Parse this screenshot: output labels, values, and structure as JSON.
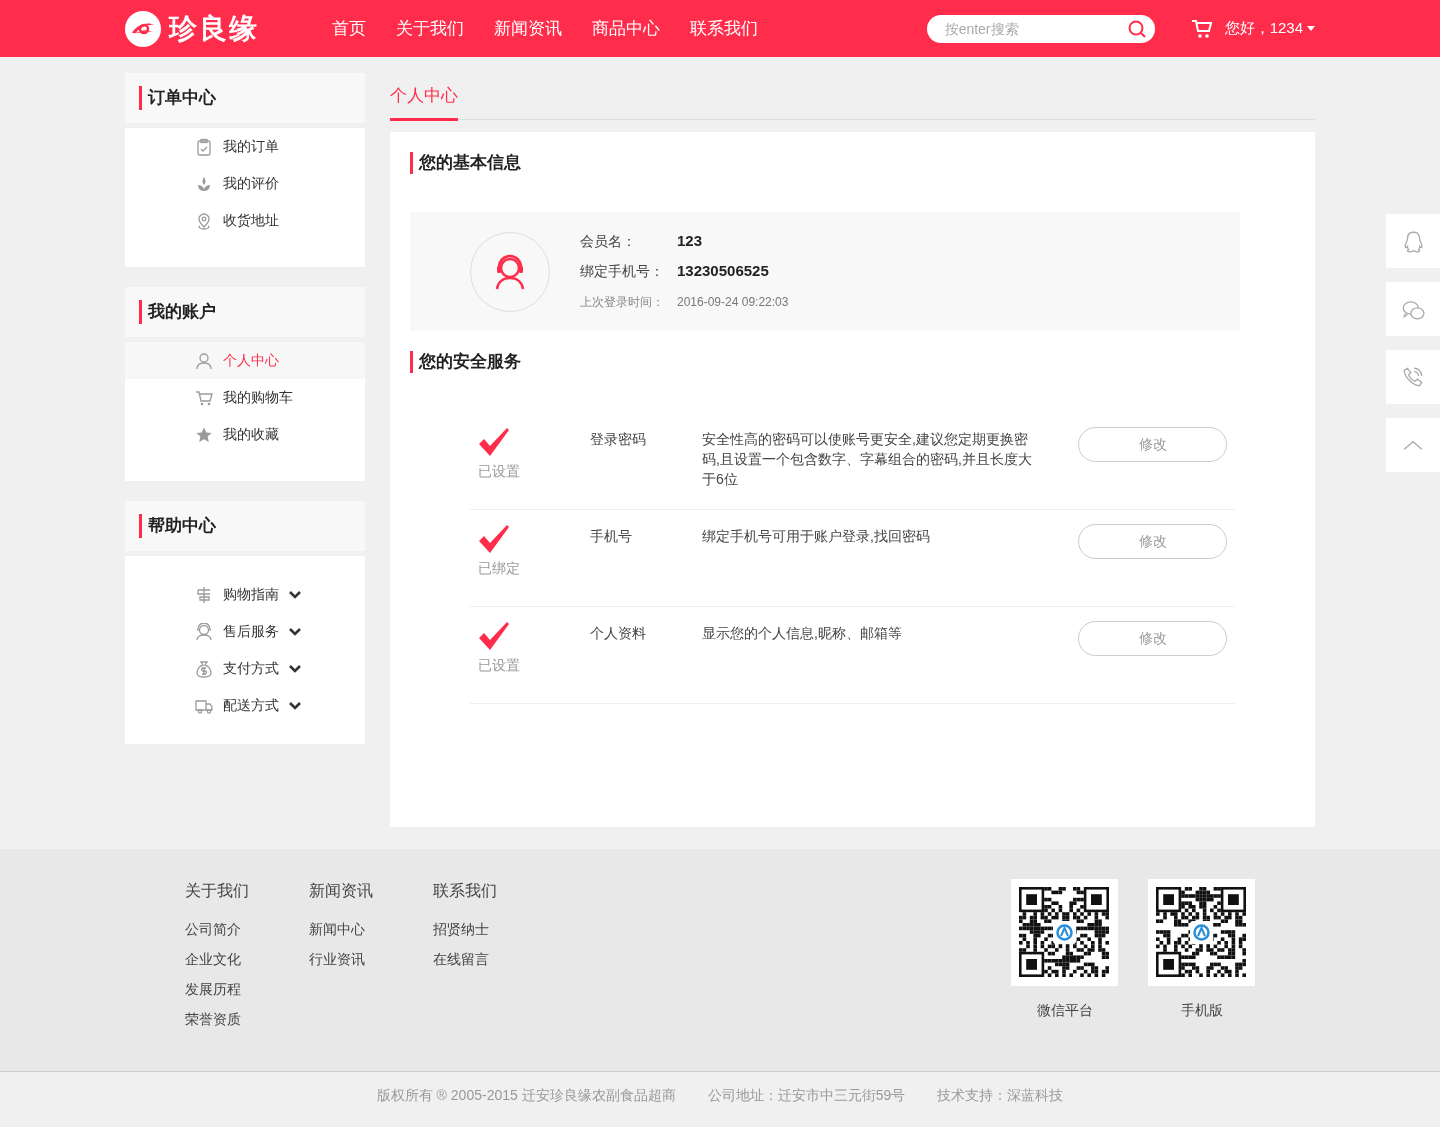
{
  "header": {
    "logo_text": "珍良缘",
    "nav": [
      {
        "label": "首页"
      },
      {
        "label": "关于我们"
      },
      {
        "label": "新闻资讯"
      },
      {
        "label": "商品中心"
      },
      {
        "label": "联系我们"
      }
    ],
    "search": {
      "placeholder": "按enter搜索"
    },
    "greeting": "您好，1234"
  },
  "sidebar": {
    "sections": [
      {
        "title": "订单中心",
        "items": [
          {
            "label": "我的订单",
            "selected": false
          },
          {
            "label": "我的评价",
            "selected": false
          },
          {
            "label": "收货地址",
            "selected": false
          }
        ]
      },
      {
        "title": "我的账户",
        "items": [
          {
            "label": "个人中心",
            "selected": true
          },
          {
            "label": "我的购物车",
            "selected": false
          },
          {
            "label": "我的收藏",
            "selected": false
          }
        ]
      },
      {
        "title": "帮助中心",
        "items": [
          {
            "label": "购物指南",
            "selected": false,
            "expanded": false
          },
          {
            "label": "售后服务",
            "selected": false,
            "expanded": false
          },
          {
            "label": "支付方式",
            "selected": false,
            "expanded": false
          },
          {
            "label": "配送方式",
            "selected": false,
            "expanded": false
          }
        ]
      }
    ]
  },
  "tabs": [
    {
      "label": "个人中心",
      "selected": true
    }
  ],
  "basic_info": {
    "title": "您的基本信息",
    "fields": [
      {
        "label": "会员名：",
        "value": "123",
        "kind": "strong"
      },
      {
        "label": "绑定手机号：",
        "value": "13230506525",
        "kind": "strong"
      },
      {
        "label": "上次登录时间：",
        "value": "2016-09-24 09:22:03",
        "kind": "muted"
      }
    ]
  },
  "security": {
    "title": "您的安全服务",
    "items": [
      {
        "done": true,
        "status": "已设置",
        "name": "登录密码",
        "description": "安全性高的密码可以使账号更安全,建议您定期更换密码,且设置一个包含数字、字幕组合的密码,并且长度大于6位",
        "button": "修改"
      },
      {
        "done": true,
        "status": "已绑定",
        "name": "手机号",
        "description": "绑定手机号可用于账户登录,找回密码",
        "button": "修改"
      },
      {
        "done": true,
        "status": "已设置",
        "name": "个人资料",
        "description": "显示您的个人信息,昵称、邮箱等",
        "button": "修改"
      }
    ]
  },
  "footer": {
    "columns": [
      {
        "title": "关于我们",
        "links": [
          "公司简介",
          "企业文化",
          "发展历程",
          "荣誉资质"
        ]
      },
      {
        "title": "新闻资讯",
        "links": [
          "新闻中心",
          "行业资讯"
        ]
      },
      {
        "title": "联系我们",
        "links": [
          "招贤纳士",
          "在线留言"
        ]
      }
    ],
    "qr_codes": [
      {
        "label": "微信平台"
      },
      {
        "label": "手机版"
      }
    ],
    "bottom": [
      "版权所有 ® 2005-2015 迁安珍良缘农副食品超商",
      "公司地址：迁安市中三元街59号",
      "技术支持：深蓝科技"
    ]
  }
}
